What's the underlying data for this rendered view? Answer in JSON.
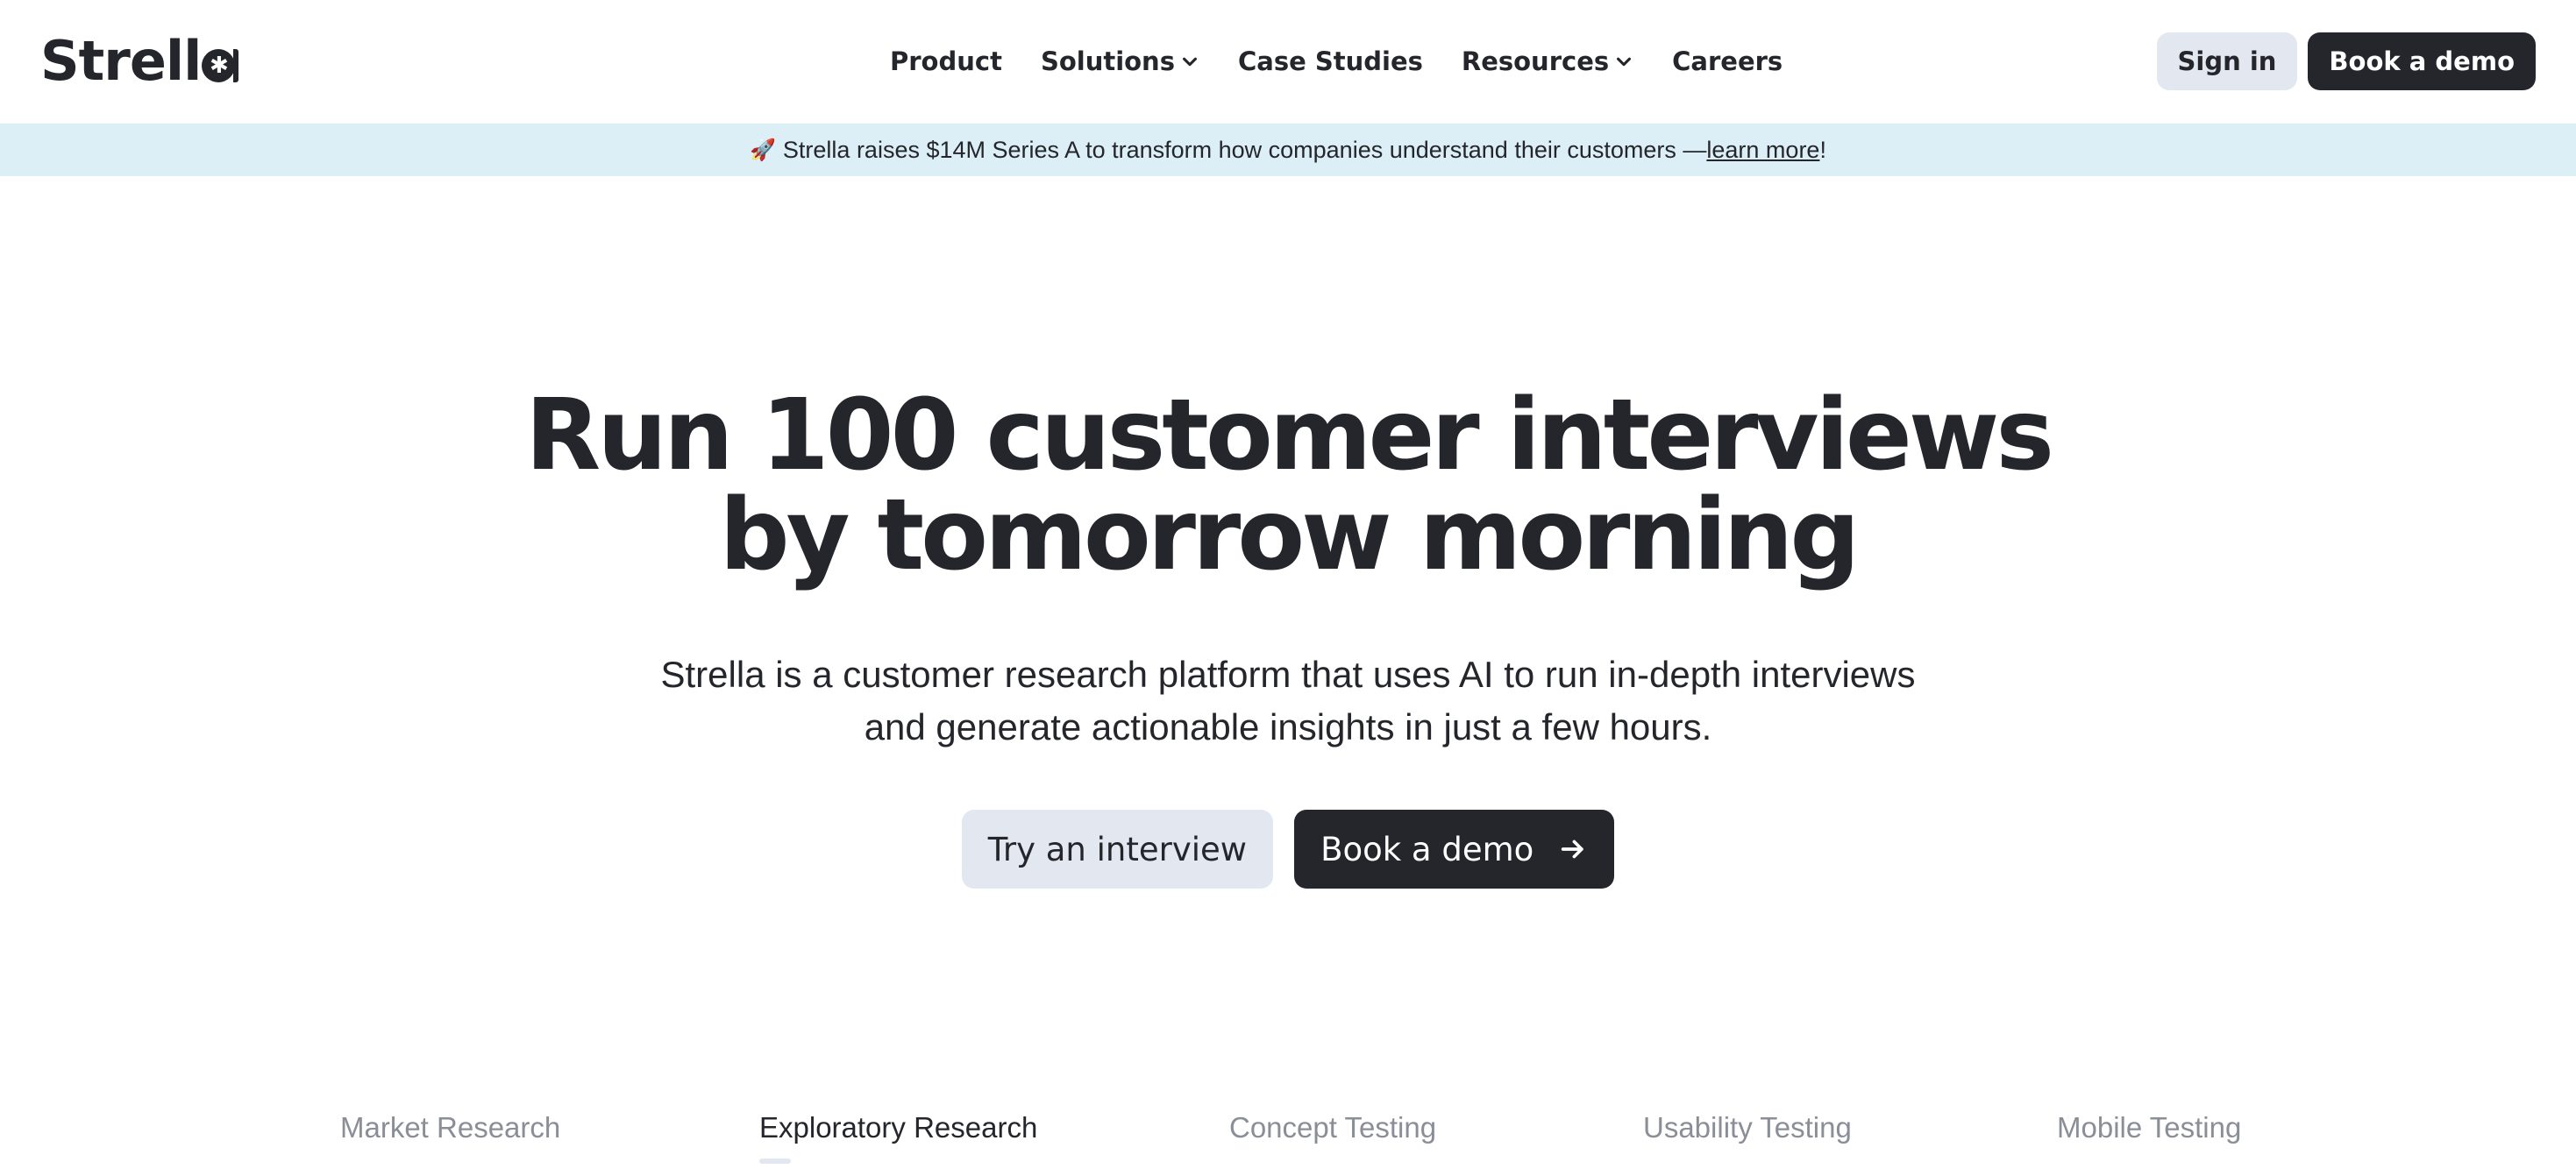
{
  "nav": {
    "logo_text": "Strell",
    "logo_mark": "✱",
    "items": [
      {
        "label": "Product",
        "has_dropdown": false
      },
      {
        "label": "Solutions",
        "has_dropdown": true
      },
      {
        "label": "Case Studies",
        "has_dropdown": false
      },
      {
        "label": "Resources",
        "has_dropdown": true
      },
      {
        "label": "Careers",
        "has_dropdown": false
      }
    ],
    "signin_label": "Sign in",
    "demo_label": "Book a demo"
  },
  "banner": {
    "icon": "🚀",
    "text": "Strella raises $14M Series A to transform how companies understand their customers — ",
    "link_text": "learn more",
    "suffix": "!"
  },
  "hero": {
    "title_line1": "Run 100 customer interviews",
    "title_line2": "by tomorrow morning",
    "subtitle_line1": "Strella is a customer research platform that uses AI to run in-depth interviews",
    "subtitle_line2": "and generate actionable insights in just a few hours.",
    "try_label": "Try an interview",
    "book_label": "Book a demo"
  },
  "tabs": {
    "items": [
      {
        "label": "Market Research"
      },
      {
        "label": "Exploratory Research"
      },
      {
        "label": "Concept Testing"
      },
      {
        "label": "Usability Testing"
      },
      {
        "label": "Mobile Testing"
      }
    ],
    "active": "Exploratory Research"
  },
  "colors": {
    "ink": "#24262b",
    "muted": "#8a8e96",
    "soft_button": "#e3e7ef",
    "banner_bg": "#dceff6"
  }
}
